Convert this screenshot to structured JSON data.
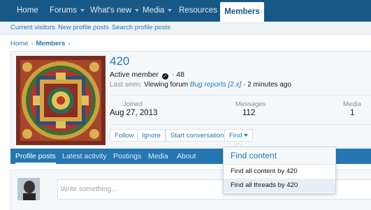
{
  "topnav": {
    "items": [
      "Home",
      "Forums",
      "What's new",
      "Media",
      "Resources"
    ],
    "active": "Members"
  },
  "subnav": [
    "Current visitors",
    "New profile posts",
    "Search profile posts"
  ],
  "breadcrumb": {
    "home": "Home",
    "members": "Members"
  },
  "profile": {
    "username": "420",
    "title": "Active member",
    "points": "48",
    "last_seen_label": "Last seen:",
    "last_seen_activity": "Viewing forum",
    "last_seen_forum": "Bug reports [2.x]",
    "last_seen_time": "2 minutes ago",
    "stats": [
      {
        "label": "Joined",
        "value": "Aug 27, 2013"
      },
      {
        "label": "Messages",
        "value": "112"
      },
      {
        "label": "Media",
        "value": "1"
      }
    ],
    "buttons": {
      "follow": "Follow",
      "ignore": "Ignore",
      "conversation": "Start conversation",
      "find": "Find"
    }
  },
  "tabs": [
    "Profile posts",
    "Latest activity",
    "Postings",
    "Media",
    "About"
  ],
  "post_box": {
    "placeholder": "Write something..."
  },
  "find_menu": {
    "header": "Find content",
    "items": [
      "Find all content by 420",
      "Find all threads by 420"
    ]
  },
  "colors": {
    "nav": "#185886",
    "accent": "#2577b1",
    "tabbar": "#2577b1",
    "panel": "#f5f8fb"
  }
}
